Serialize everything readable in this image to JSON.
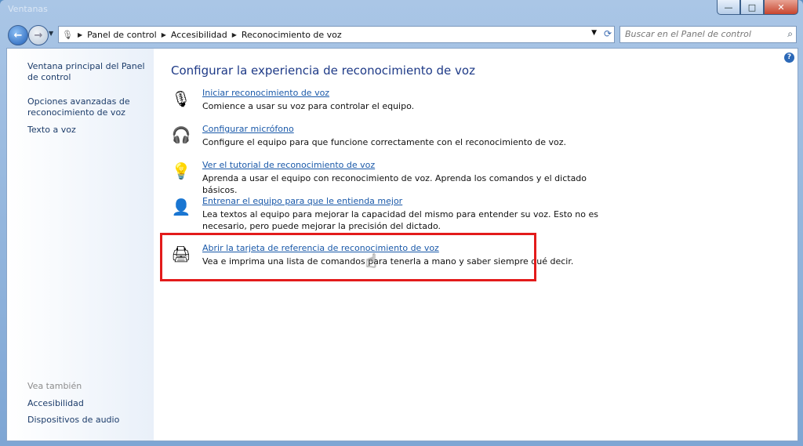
{
  "window": {
    "title": "Ventanas"
  },
  "caption": {
    "minimize": "—",
    "maximize": "□",
    "close": "✕"
  },
  "nav": {
    "breadcrumbs": [
      "Panel de control",
      "Accesibilidad",
      "Reconocimiento de voz"
    ],
    "search_placeholder": "Buscar en el Panel de control"
  },
  "sidebar": {
    "links": [
      "Ventana principal del Panel de control",
      "Opciones avanzadas de reconocimiento de voz",
      "Texto a voz"
    ],
    "see_also_heading": "Vea también",
    "see_also": [
      "Accesibilidad",
      "Dispositivos de audio"
    ]
  },
  "main": {
    "heading": "Configurar la experiencia de reconocimiento de voz",
    "tasks": [
      {
        "icon": "microphone-icon",
        "link": "Iniciar reconocimiento de voz",
        "desc": "Comience a usar su voz para controlar el equipo."
      },
      {
        "icon": "headset-icon",
        "link": "Configurar micrófono",
        "desc": "Configure el equipo para que funcione correctamente con el reconocimiento de voz."
      },
      {
        "icon": "lightbulb-icon",
        "link": "Ver el tutorial de reconocimiento de voz",
        "desc": "Aprenda a usar el equipo con reconocimiento de voz. Aprenda los comandos y el dictado básicos."
      },
      {
        "icon": "user-icon",
        "link": "Entrenar el equipo para que le entienda mejor",
        "desc": "Lea textos al equipo para mejorar la capacidad del mismo para entender su voz. Esto no es necesario, pero puede mejorar la precisión del dictado."
      },
      {
        "icon": "printer-icon",
        "link": "Abrir la tarjeta de referencia de reconocimiento de voz",
        "desc": "Vea e imprima una lista de comandos para tenerla a mano y saber siempre qué decir."
      }
    ]
  },
  "colors": {
    "highlight": "#e31b1b",
    "link": "#1a59a9",
    "heading": "#1e3a87"
  }
}
